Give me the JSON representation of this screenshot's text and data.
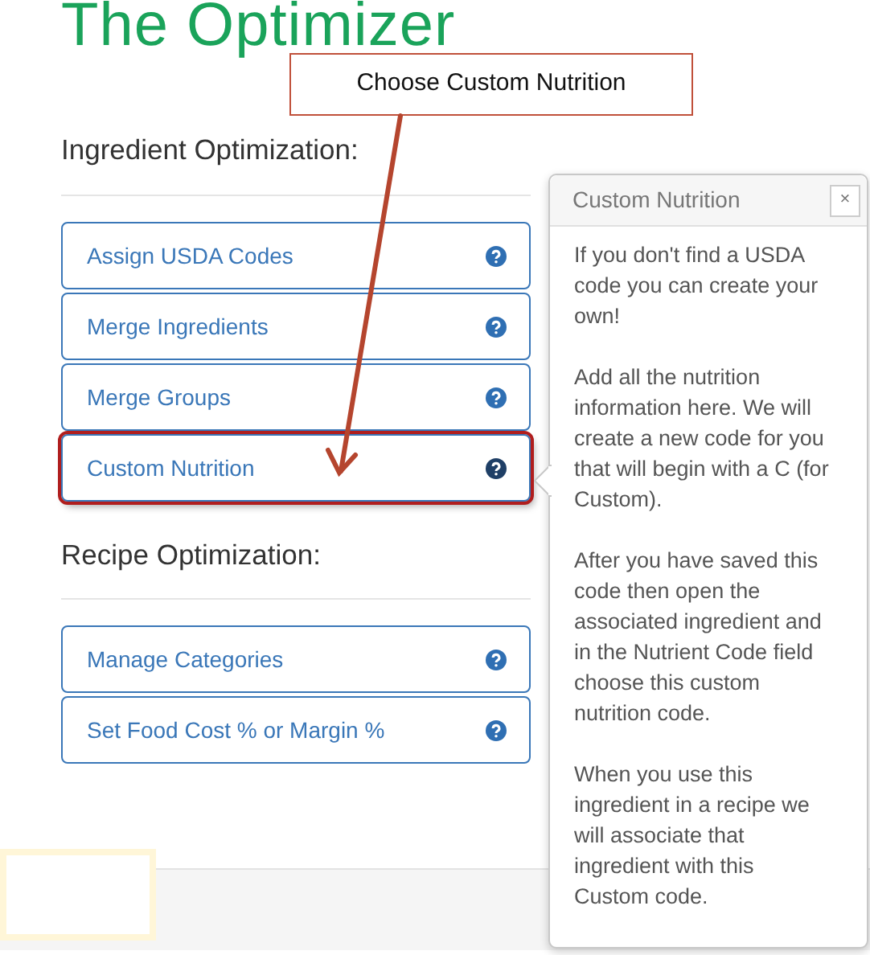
{
  "title": "The Optimizer",
  "callout": {
    "text": "Choose Custom Nutrition"
  },
  "sections": [
    {
      "heading": "Ingredient Optimization:",
      "items": [
        {
          "label": "Assign USDA Codes",
          "highlighted": false
        },
        {
          "label": "Merge Ingredients",
          "highlighted": false
        },
        {
          "label": "Merge Groups",
          "highlighted": false
        },
        {
          "label": "Custom Nutrition",
          "highlighted": true
        }
      ]
    },
    {
      "heading": "Recipe Optimization:",
      "items": [
        {
          "label": "Manage Categories",
          "highlighted": false
        },
        {
          "label": "Set Food Cost % or Margin %",
          "highlighted": false
        }
      ]
    }
  ],
  "popover": {
    "title": "Custom Nutrition",
    "close": "×",
    "paragraphs": [
      "If you don't find a USDA code you can create your own!",
      "Add all the nutrition information here. We will create a new code for you that will begin with a C (for Custom).",
      "After you have saved this code then open the associated ingredient and in the Nutrient Code field choose this custom nutrition code.",
      "When you use this ingredient in a recipe we will associate that ingredient with this Custom code."
    ]
  }
}
